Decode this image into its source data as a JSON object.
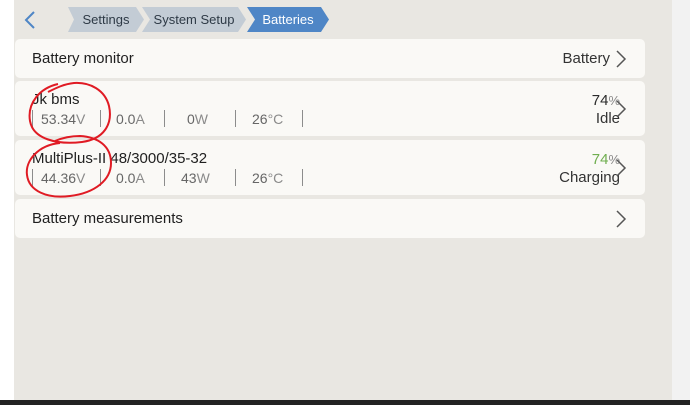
{
  "breadcrumbs": [
    "Settings",
    "System Setup",
    "Batteries"
  ],
  "monitor": {
    "label": "Battery monitor",
    "value": "Battery"
  },
  "batteries": [
    {
      "name": "Jk bms",
      "voltage": "53.34",
      "voltage_unit": "V",
      "current": "0.0",
      "current_unit": "A",
      "power": "0",
      "power_unit": "W",
      "temperature": "26",
      "temperature_unit": "°C",
      "soc": "74",
      "soc_unit": "%",
      "soc_color": "#2b2b2b",
      "state": "Idle"
    },
    {
      "name": "MultiPlus-II 48/3000/35-32",
      "voltage": "44.36",
      "voltage_unit": "V",
      "current": "0.0",
      "current_unit": "A",
      "power": "43",
      "power_unit": "W",
      "temperature": "26",
      "temperature_unit": "°C",
      "soc": "74",
      "soc_unit": "%",
      "soc_color": "#6fae4f",
      "state": "Charging"
    }
  ],
  "measurements": {
    "label": "Battery measurements"
  },
  "colors": {
    "breadcrumb_active": "#4f86c6",
    "breadcrumb_inactive": "#c3ccd5",
    "annotation": "#e01b24"
  }
}
